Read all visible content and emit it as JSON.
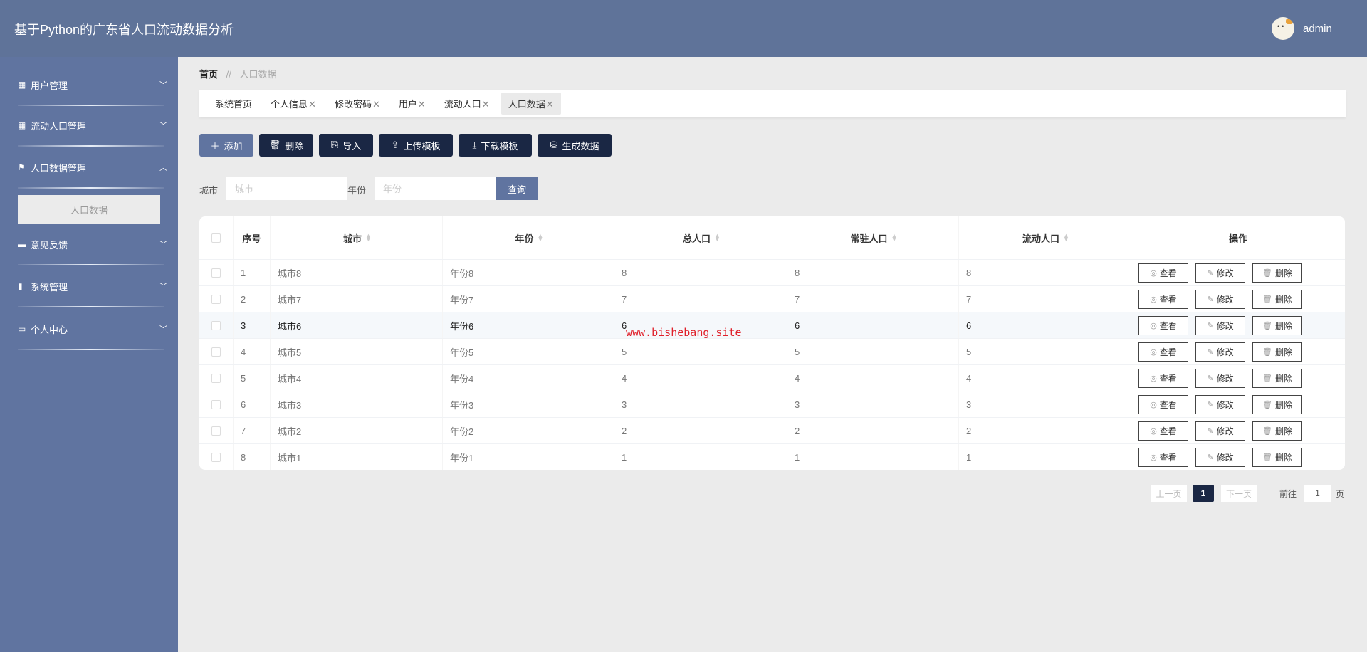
{
  "header": {
    "title": "基于Python的广东省人口流动数据分析",
    "username": "admin"
  },
  "sidebar": {
    "items": [
      {
        "label": "用户管理",
        "icon": "grid-icon",
        "expanded": false
      },
      {
        "label": "流动人口管理",
        "icon": "grid-icon",
        "expanded": false
      },
      {
        "label": "人口数据管理",
        "icon": "flag-icon",
        "expanded": true,
        "children": [
          {
            "label": "人口数据"
          }
        ]
      },
      {
        "label": "意见反馈",
        "icon": "monitor-icon",
        "expanded": false
      },
      {
        "label": "系统管理",
        "icon": "bar-chart-icon",
        "expanded": false
      },
      {
        "label": "个人中心",
        "icon": "id-card-icon",
        "expanded": false
      }
    ]
  },
  "breadcrumb": {
    "home": "首页",
    "sep": "//",
    "current": "人口数据"
  },
  "tabs": [
    {
      "label": "系统首页",
      "closable": false
    },
    {
      "label": "个人信息",
      "closable": true
    },
    {
      "label": "修改密码",
      "closable": true
    },
    {
      "label": "用户",
      "closable": true
    },
    {
      "label": "流动人口",
      "closable": true
    },
    {
      "label": "人口数据",
      "closable": true,
      "active": true
    }
  ],
  "close_glyph": "✕",
  "toolbar": {
    "add": "添加",
    "delete": "删除",
    "import": "导入",
    "upload": "上传模板",
    "download": "下载模板",
    "generate": "生成数据"
  },
  "search": {
    "city_label": "城市",
    "city_placeholder": "城市",
    "city_value": "",
    "year_label": "年份",
    "year_placeholder": "年份",
    "year_value": "",
    "query": "查询"
  },
  "table": {
    "columns": [
      "序号",
      "城市",
      "年份",
      "总人口",
      "常驻人口",
      "流动人口",
      "操作"
    ],
    "rows": [
      [
        "1",
        "城市8",
        "年份8",
        "8",
        "8",
        "8"
      ],
      [
        "2",
        "城市7",
        "年份7",
        "7",
        "7",
        "7"
      ],
      [
        "3",
        "城市6",
        "年份6",
        "6",
        "6",
        "6"
      ],
      [
        "4",
        "城市5",
        "年份5",
        "5",
        "5",
        "5"
      ],
      [
        "5",
        "城市4",
        "年份4",
        "4",
        "4",
        "4"
      ],
      [
        "6",
        "城市3",
        "年份3",
        "3",
        "3",
        "3"
      ],
      [
        "7",
        "城市2",
        "年份2",
        "2",
        "2",
        "2"
      ],
      [
        "8",
        "城市1",
        "年份1",
        "1",
        "1",
        "1"
      ]
    ],
    "actions": {
      "view": "查看",
      "edit": "修改",
      "delete": "删除"
    }
  },
  "pagination": {
    "prev": "上一页",
    "current": "1",
    "next": "下一页",
    "goto_label": "前往",
    "goto_value": "1",
    "page_suffix": "页"
  },
  "watermark": "www.bishebang.site"
}
